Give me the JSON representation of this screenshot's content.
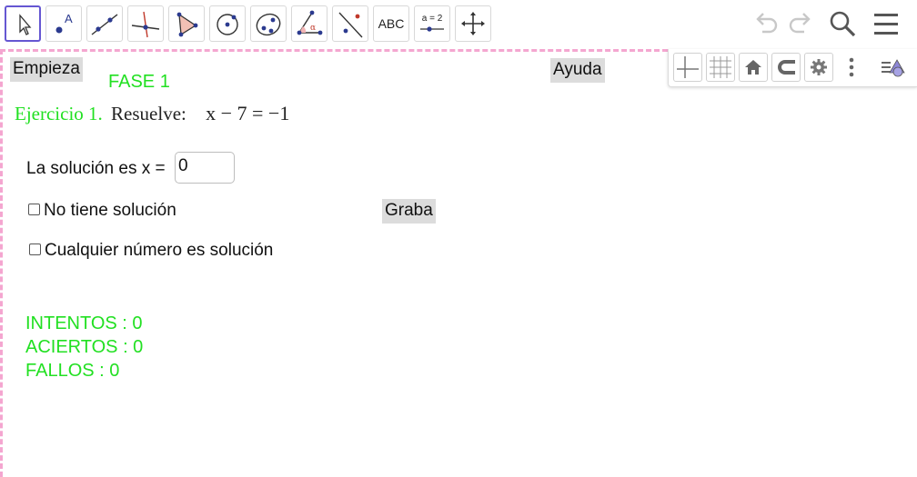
{
  "toolbar": {
    "tools": [
      {
        "icon": "move-arrow-icon"
      },
      {
        "icon": "point-icon",
        "label": "A"
      },
      {
        "icon": "line-icon"
      },
      {
        "icon": "perpendicular-line-icon"
      },
      {
        "icon": "polygon-icon"
      },
      {
        "icon": "circle-center-point-icon"
      },
      {
        "icon": "ellipse-icon"
      },
      {
        "icon": "angle-icon",
        "label": "α"
      },
      {
        "icon": "reflect-icon"
      },
      {
        "icon": "text-icon",
        "label": "ABC"
      },
      {
        "icon": "slider-icon",
        "label": "a = 2"
      },
      {
        "icon": "move-graphics-view-icon"
      }
    ],
    "right": [
      "undo-icon",
      "redo-icon",
      "search-icon",
      "menu-icon"
    ]
  },
  "style_bar": [
    "axes-icon",
    "grid-icon",
    "home-icon",
    "magnet-icon",
    "gear-icon",
    "more-vert-icon",
    "toggle-stylebar-icon"
  ],
  "buttons": {
    "empieza": "Empieza",
    "ayuda": "Ayuda",
    "graba": "Graba"
  },
  "fase": "FASE 1",
  "exercise": {
    "label": "Ejercicio 1.",
    "instruction": "Resuelve:",
    "equation": "x − 7 = −1"
  },
  "answer": {
    "label": "La solución es x =",
    "value": "0"
  },
  "options": {
    "no_solution": "No tiene solución",
    "any_number": "Cualquier número es solución"
  },
  "stats": {
    "intentos": "INTENTOS : 0",
    "aciertos": "ACIERTOS : 0",
    "fallos": "FALLOS : 0"
  },
  "colors": {
    "accent_green": "#22e022",
    "selected_tool_border": "#6557d2",
    "dashed_border": "#f4a6d0"
  }
}
